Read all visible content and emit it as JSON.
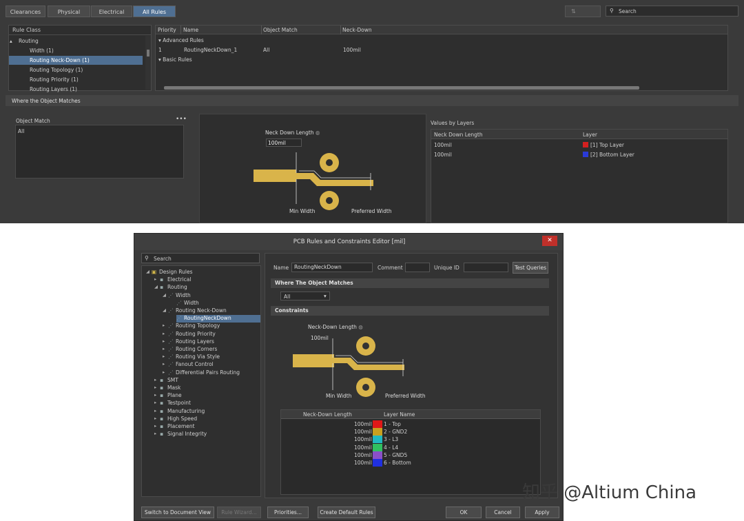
{
  "top": {
    "tabs": [
      "Clearances",
      "Physical",
      "Electrical",
      "All Rules"
    ],
    "active_tab": "All Rules",
    "search_placeholder": "Search",
    "rule_class_header": "Rule Class",
    "rule_classes": [
      {
        "label": "Routing",
        "level": 0,
        "selected": false
      },
      {
        "label": "Width (1)",
        "level": 1,
        "selected": false
      },
      {
        "label": "Routing Neck-Down (1)",
        "level": 1,
        "selected": true
      },
      {
        "label": "Routing Topology (1)",
        "level": 1,
        "selected": false
      },
      {
        "label": "Routing Priority (1)",
        "level": 1,
        "selected": false
      },
      {
        "label": "Routing Layers (1)",
        "level": 1,
        "selected": false
      }
    ],
    "rules_table": {
      "columns": [
        "Priority",
        "Name",
        "Object Match",
        "Neck-Down"
      ],
      "group_advanced": "Advanced Rules",
      "group_basic": "Basic Rules",
      "row": {
        "priority": "1",
        "name": "RoutingNeckDown_1",
        "object_match": "All",
        "neck_down": "100mil"
      }
    },
    "where_header": "Where the Object Matches",
    "object_match_label": "Object Match",
    "object_match_value": "All",
    "diagram": {
      "neck_down_label": "Neck Down Length",
      "value": "100mil",
      "min_width": "Min Width",
      "preferred_width": "Preferred Width"
    },
    "values_by_layers": {
      "title": "Values by Layers",
      "columns": [
        "Neck Down Length",
        "Layer"
      ],
      "rows": [
        {
          "value": "100mil",
          "layer": "[1] Top Layer",
          "color": "#d42020"
        },
        {
          "value": "100mil",
          "layer": "[2] Bottom Layer",
          "color": "#2a3ad8"
        }
      ]
    }
  },
  "dialog": {
    "title": "PCB Rules and Constraints Editor [mil]",
    "search_placeholder": "Search",
    "tree": [
      {
        "label": "Design Rules",
        "level": 0
      },
      {
        "label": "Electrical",
        "level": 1
      },
      {
        "label": "Routing",
        "level": 1
      },
      {
        "label": "Width",
        "level": 2
      },
      {
        "label": "Width",
        "level": 3
      },
      {
        "label": "Routing Neck-Down",
        "level": 2
      },
      {
        "label": "RoutingNeckDown",
        "level": 3,
        "selected": true
      },
      {
        "label": "Routing Topology",
        "level": 2
      },
      {
        "label": "Routing Priority",
        "level": 2
      },
      {
        "label": "Routing Layers",
        "level": 2
      },
      {
        "label": "Routing Corners",
        "level": 2
      },
      {
        "label": "Routing Via Style",
        "level": 2
      },
      {
        "label": "Fanout Control",
        "level": 2
      },
      {
        "label": "Differential Pairs Routing",
        "level": 2
      },
      {
        "label": "SMT",
        "level": 1
      },
      {
        "label": "Mask",
        "level": 1
      },
      {
        "label": "Plane",
        "level": 1
      },
      {
        "label": "Testpoint",
        "level": 1
      },
      {
        "label": "Manufacturing",
        "level": 1
      },
      {
        "label": "High Speed",
        "level": 1
      },
      {
        "label": "Placement",
        "level": 1
      },
      {
        "label": "Signal Integrity",
        "level": 1
      }
    ],
    "name_label": "Name",
    "name_value": "RoutingNeckDown",
    "comment_label": "Comment",
    "unique_id_label": "Unique ID",
    "test_queries": "Test Queries",
    "where_header": "Where The Object Matches",
    "match_select": "All",
    "constraints_header": "Constraints",
    "diagram": {
      "neck_down_label": "Neck-Down Length",
      "value": "100mil",
      "min_width": "Min Width",
      "preferred_width": "Preferred Width"
    },
    "layer_table": {
      "columns": [
        "Neck-Down Length",
        "Layer Name"
      ],
      "rows": [
        {
          "value": "100mil",
          "layer": "1 - Top",
          "color": "#e01818"
        },
        {
          "value": "100mil",
          "layer": "2 - GND2",
          "color": "#c8a020"
        },
        {
          "value": "100mil",
          "layer": "3 - L3",
          "color": "#20b8c0"
        },
        {
          "value": "100mil",
          "layer": "4 - L4",
          "color": "#30c060"
        },
        {
          "value": "100mil",
          "layer": "5 - GND5",
          "color": "#8a50c8"
        },
        {
          "value": "100mil",
          "layer": "6 - Bottom",
          "color": "#2030e0"
        }
      ]
    },
    "buttons": {
      "switch_view": "Switch to Document View",
      "rule_wizard": "Rule Wizard...",
      "priorities": "Priorities...",
      "create_default": "Create Default Rules",
      "ok": "OK",
      "cancel": "Cancel",
      "apply": "Apply"
    }
  },
  "watermark": "知乎 @Altium China"
}
